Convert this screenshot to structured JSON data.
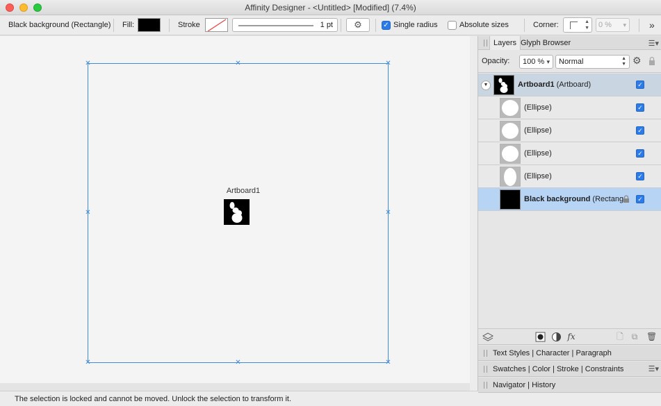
{
  "window": {
    "title": "Affinity Designer - <Untitled> [Modified] (7.4%)"
  },
  "toolbar": {
    "selection_label": "Black background (Rectangle)",
    "fill_label": "Fill:",
    "fill_color": "#000000",
    "stroke_label": "Stroke",
    "stroke_width": "1 pt",
    "single_radius_label": "Single radius",
    "single_radius_checked": true,
    "absolute_sizes_label": "Absolute sizes",
    "absolute_sizes_checked": false,
    "corner_label": "Corner:",
    "corner_amount": "0 %",
    "more_icon": "chevron-double-right-icon"
  },
  "canvas": {
    "artboard_label": "Artboard1",
    "selection_color": "#3f8bd8"
  },
  "status": {
    "message": "The selection is locked and cannot be moved. Unlock the selection to transform it."
  },
  "panel": {
    "tabs": [
      "Layers",
      "Glyph Browser"
    ],
    "active_tab": "Layers",
    "opacity_label": "Opacity:",
    "opacity_value": "100 %",
    "blend_mode": "Normal",
    "layers": [
      {
        "name": "Artboard1",
        "type": "(Artboard)",
        "visible": true,
        "kind": "artboard"
      },
      {
        "name": "",
        "type": "(Ellipse)",
        "visible": true,
        "kind": "ellipse"
      },
      {
        "name": "",
        "type": "(Ellipse)",
        "visible": true,
        "kind": "ellipse"
      },
      {
        "name": "",
        "type": "(Ellipse)",
        "visible": true,
        "kind": "ellipse"
      },
      {
        "name": "",
        "type": "(Ellipse)",
        "visible": true,
        "kind": "ellipse-tall"
      },
      {
        "name": "Black background",
        "type": "(Rectang",
        "visible": true,
        "locked": true,
        "kind": "rectangle"
      }
    ],
    "collapsed_groups": [
      [
        "Text Styles",
        "Character",
        "Paragraph"
      ],
      [
        "Swatches",
        "Color",
        "Stroke",
        "Constraints"
      ],
      [
        "Navigator",
        "History"
      ]
    ]
  }
}
